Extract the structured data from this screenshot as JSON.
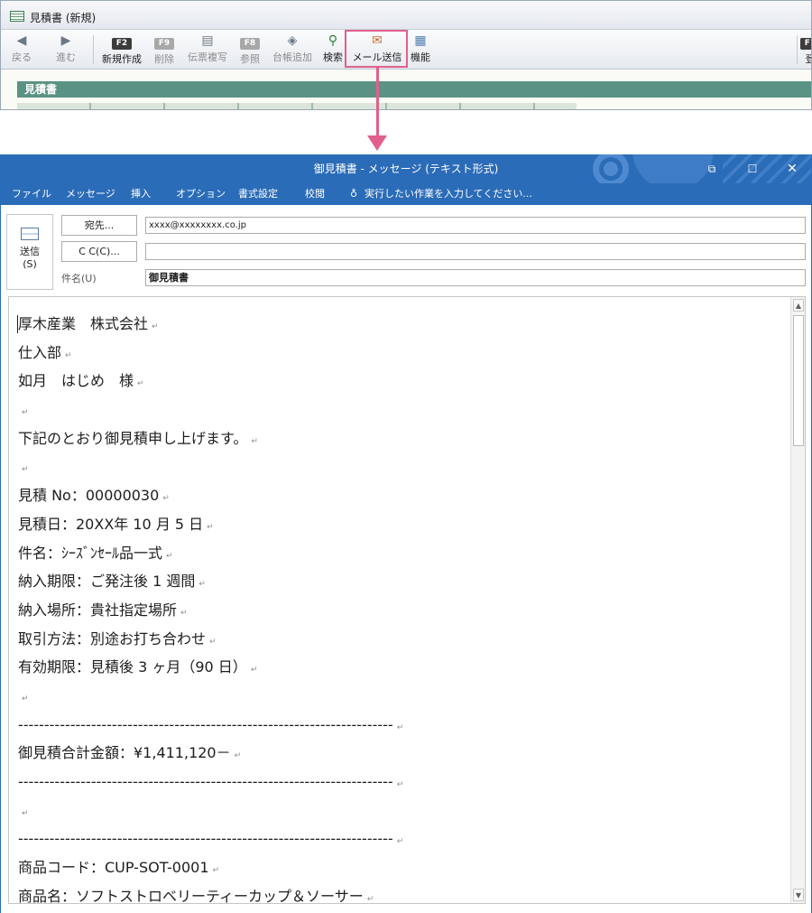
{
  "app": {
    "title": "見積書 (新規)",
    "toolbar": [
      {
        "key": "",
        "icon": "◀",
        "label": "戻る",
        "enabled": false
      },
      {
        "key": "",
        "icon": "▶",
        "label": "進む",
        "enabled": false
      },
      {
        "key": "F2",
        "icon": "",
        "label": "新規作成",
        "enabled": true
      },
      {
        "key": "F9",
        "icon": "",
        "label": "削除",
        "enabled": false
      },
      {
        "key": "",
        "icon": "▤",
        "label": "伝票複写",
        "enabled": false
      },
      {
        "key": "F8",
        "icon": "",
        "label": "参照",
        "enabled": false
      },
      {
        "key": "",
        "icon": "◈",
        "label": "台帳追加",
        "enabled": false
      },
      {
        "key": "",
        "icon": "⚲",
        "label": "検索",
        "enabled": true
      },
      {
        "key": "",
        "icon": "✉",
        "label": "メール送信",
        "enabled": true
      },
      {
        "key": "",
        "icon": "▦",
        "label": "機能",
        "enabled": true
      },
      {
        "key": "F1",
        "icon": "",
        "label": "登",
        "enabled": true
      }
    ],
    "section_title": "見積書"
  },
  "mail": {
    "title": "御見積書 - メッセージ (テキスト形式)",
    "ribbon_tabs": [
      "ファイル",
      "メッセージ",
      "挿入",
      "オプション",
      "書式設定",
      "校閲"
    ],
    "tell_me": "実行したい作業を入力してください...",
    "send_label": "送信\n(S)",
    "to_button": "宛先...",
    "cc_button": "C C(C)...",
    "subject_label": "件名(U)",
    "to_value": "xxxx@xxxxxxxx.co.jp",
    "cc_value": "",
    "subject_value": "御見積書",
    "colors": {
      "accent": "#2b6cb8",
      "highlight": "#e0608e",
      "section": "#5a9383"
    }
  },
  "body_lines": [
    "厚木産業　株式会社",
    "仕入部",
    "如月　はじめ　様",
    "",
    "下記のとおり御見積申し上げます。",
    "",
    "見積 No：00000030",
    "見積日：20XX年 10 月 5 日",
    "件名：ｼｰｽﾞﾝｾｰﾙ品一式",
    "納入期限：ご発注後 1 週間",
    "納入場所：貴社指定場所",
    "取引方法：別途お打ち合わせ",
    "有効期限：見積後 3 ヶ月（90 日）",
    "",
    "------------------------------------------------------------------------",
    "御見積合計金額：¥1,411,120－",
    "------------------------------------------------------------------------",
    "",
    "------------------------------------------------------------------------",
    "商品コード：CUP-SOT-0001",
    "商品名：ソフトストロベリーティーカップ＆ソーサー"
  ]
}
